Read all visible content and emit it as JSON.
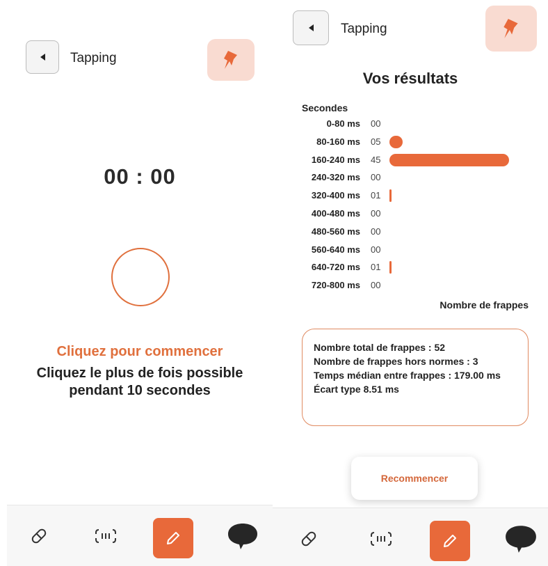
{
  "theme": {
    "accent": "#e8693a",
    "accent_light": "#f9dbd1"
  },
  "left_screen": {
    "header": {
      "title": "Tapping",
      "back_icon": "back-arrow-icon",
      "pin_icon": "pin-icon"
    },
    "timer": "00  :  00",
    "prompt": "Cliquez pour commencer",
    "instruction": "Cliquez le plus de fois possible pendant 10 secondes"
  },
  "right_screen": {
    "header": {
      "title": "Tapping",
      "back_icon": "back-arrow-icon",
      "pin_icon": "pin-icon"
    },
    "results_title": "Vos résultats",
    "y_axis_label": "Secondes",
    "x_axis_label": "Nombre de frappes",
    "stats": {
      "total": "Nombre total de frappes : 52",
      "outliers": "Nombre de frappes hors normes : 3",
      "median": "Temps médian entre frappes : 179.00 ms",
      "stddev": "Écart type 8.51 ms"
    },
    "restart_label": "Recommencer"
  },
  "chart_data": {
    "type": "bar",
    "orientation": "horizontal",
    "ylabel": "Secondes",
    "xlabel": "Nombre de frappes",
    "categories": [
      "0-80 ms",
      "80-160 ms",
      "160-240 ms",
      "240-320 ms",
      "320-400 ms",
      "400-480 ms",
      "480-560 ms",
      "560-640 ms",
      "640-720 ms",
      "720-800 ms"
    ],
    "labels": [
      "00",
      "05",
      "45",
      "00",
      "01",
      "00",
      "00",
      "00",
      "01",
      "00"
    ],
    "values": [
      0,
      5,
      45,
      0,
      1,
      0,
      0,
      0,
      1,
      0
    ],
    "grid": false
  },
  "tabbar": {
    "items": [
      {
        "icon": "pill-icon"
      },
      {
        "icon": "scan-icon"
      },
      {
        "icon": "pencil-icon",
        "active": true
      },
      {
        "icon": "chat-bubble-icon"
      }
    ]
  }
}
